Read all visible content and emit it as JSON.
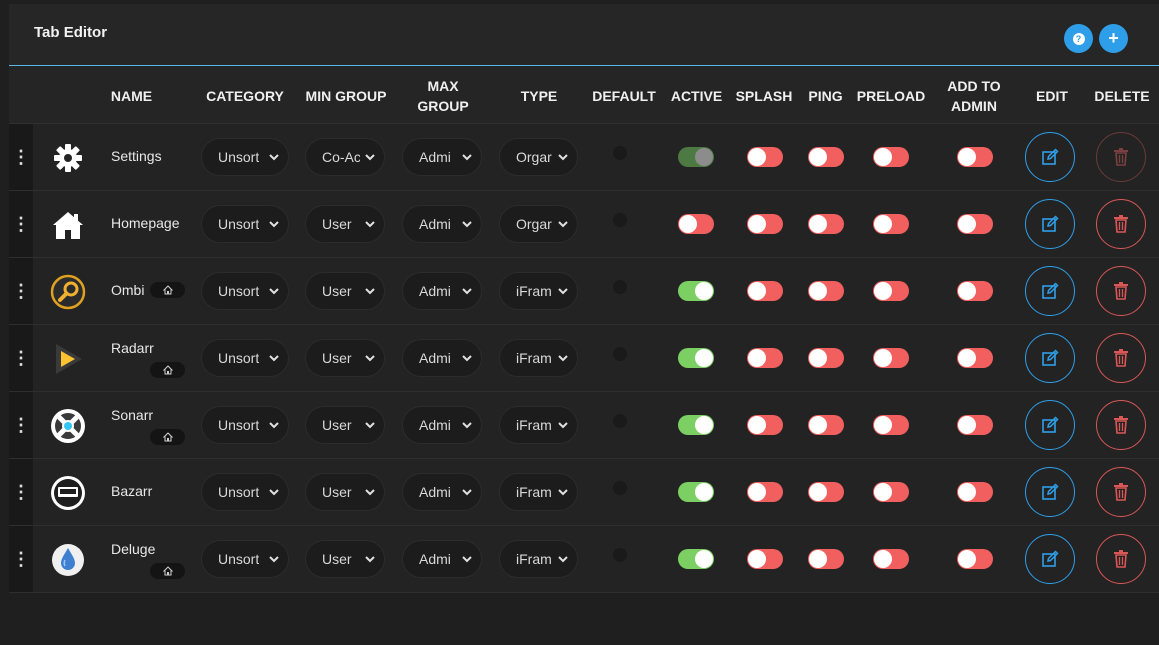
{
  "panel": {
    "title": "Tab Editor",
    "help_icon": "question-circle-icon",
    "add_icon": "plus-icon"
  },
  "colors": {
    "accent": "#2f9ee8",
    "toggle_on": "#7ccf63",
    "toggle_off": "#f25f5f",
    "delete": "#d95757"
  },
  "headers": {
    "name": "NAME",
    "category": "CATEGORY",
    "min_group": "MIN GROUP",
    "max_group_line1": "MAX",
    "max_group_line2": "GROUP",
    "type": "TYPE",
    "default": "DEFAULT",
    "active": "ACTIVE",
    "splash": "SPLASH",
    "ping": "PING",
    "preload": "PRELOAD",
    "add_to_admin_line1": "ADD TO",
    "add_to_admin_line2": "ADMIN",
    "edit": "EDIT",
    "delete": "DELETE"
  },
  "rows": [
    {
      "name": "Settings",
      "icon": "gear-icon",
      "homepage_badge": false,
      "category": "Unsort",
      "min_group": "Co-Ac",
      "max_group": "Admi",
      "type": "Orgar",
      "default": false,
      "active": true,
      "active_disabled": true,
      "splash": false,
      "ping": false,
      "preload": false,
      "add_to_admin": false,
      "delete_disabled": true
    },
    {
      "name": "Homepage",
      "icon": "home-icon",
      "homepage_badge": false,
      "category": "Unsort",
      "min_group": "User",
      "max_group": "Admi",
      "type": "Orgar",
      "default": false,
      "active": false,
      "active_disabled": false,
      "splash": false,
      "ping": false,
      "preload": false,
      "add_to_admin": false,
      "delete_disabled": false
    },
    {
      "name": "Ombi",
      "icon": "ombi-search-icon",
      "homepage_badge": true,
      "category": "Unsort",
      "min_group": "User",
      "max_group": "Admi",
      "type": "iFram",
      "default": false,
      "active": true,
      "active_disabled": false,
      "splash": false,
      "ping": false,
      "preload": false,
      "add_to_admin": false,
      "delete_disabled": false
    },
    {
      "name": "Radarr",
      "icon": "radarr-play-icon",
      "homepage_badge": true,
      "category": "Unsort",
      "min_group": "User",
      "max_group": "Admi",
      "type": "iFram",
      "default": false,
      "active": true,
      "active_disabled": false,
      "splash": false,
      "ping": false,
      "preload": false,
      "add_to_admin": false,
      "delete_disabled": false
    },
    {
      "name": "Sonarr",
      "icon": "sonarr-icon",
      "homepage_badge": true,
      "category": "Unsort",
      "min_group": "User",
      "max_group": "Admi",
      "type": "iFram",
      "default": false,
      "active": true,
      "active_disabled": false,
      "splash": false,
      "ping": false,
      "preload": false,
      "add_to_admin": false,
      "delete_disabled": false
    },
    {
      "name": "Bazarr",
      "icon": "bazarr-icon",
      "homepage_badge": false,
      "category": "Unsort",
      "min_group": "User",
      "max_group": "Admi",
      "type": "iFram",
      "default": false,
      "active": true,
      "active_disabled": false,
      "splash": false,
      "ping": false,
      "preload": false,
      "add_to_admin": false,
      "delete_disabled": false
    },
    {
      "name": "Deluge",
      "icon": "deluge-drop-icon",
      "homepage_badge": true,
      "category": "Unsort",
      "min_group": "User",
      "max_group": "Admi",
      "type": "iFram",
      "default": false,
      "active": true,
      "active_disabled": false,
      "splash": false,
      "ping": false,
      "preload": false,
      "add_to_admin": false,
      "delete_disabled": false
    }
  ]
}
